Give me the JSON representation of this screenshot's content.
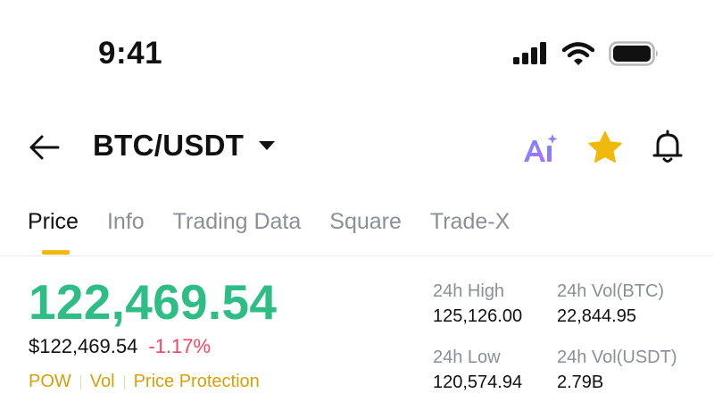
{
  "status_bar": {
    "time": "9:41",
    "icons": [
      "cellular-signal-icon",
      "wifi-icon",
      "battery-icon"
    ]
  },
  "header": {
    "pair": "BTC/USDT",
    "icons": [
      "back-arrow-icon",
      "dropdown-caret-icon",
      "ai-assistant-icon",
      "star-icon",
      "bell-icon"
    ],
    "colors": {
      "star": "#f0b90b",
      "ai_gradient_start": "#6a8cff",
      "ai_gradient_end": "#b46cff"
    }
  },
  "tabs": [
    {
      "label": "Price",
      "active": true
    },
    {
      "label": "Info",
      "active": false
    },
    {
      "label": "Trading Data",
      "active": false
    },
    {
      "label": "Square",
      "active": false
    },
    {
      "label": "Trade-X",
      "active": false
    }
  ],
  "price": {
    "last": "122,469.54",
    "usd": "$122,469.54",
    "change": "-1.17%",
    "colors": {
      "up": "#2ebd85",
      "down": "#f6465d",
      "tag": "#d89f07"
    }
  },
  "tags": [
    "POW",
    "Vol",
    "Price Protection"
  ],
  "stats": {
    "high_label": "24h High",
    "high_value": "125,126.00",
    "vol_btc_label": "24h Vol(BTC)",
    "vol_btc_value": "22,844.95",
    "low_label": "24h Low",
    "low_value": "120,574.94",
    "vol_usdt_label": "24h Vol(USDT)",
    "vol_usdt_value": "2.79B"
  }
}
